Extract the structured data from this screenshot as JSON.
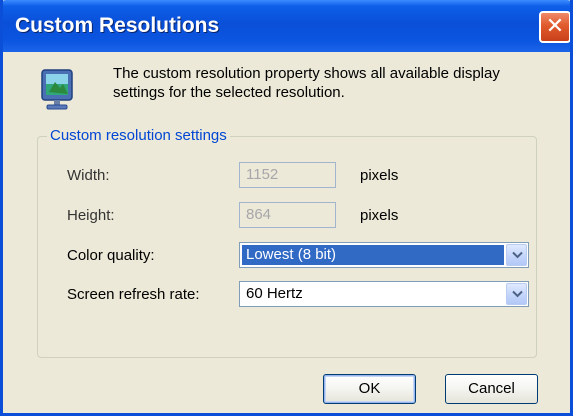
{
  "window": {
    "title": "Custom Resolutions",
    "close_label": "✕"
  },
  "intro": {
    "text": "The custom resolution property shows all available display settings for the selected resolution."
  },
  "group": {
    "label": "Custom resolution settings",
    "width": {
      "label": "Width:",
      "value": "1152",
      "unit": "pixels"
    },
    "height": {
      "label": "Height:",
      "value": "864",
      "unit": "pixels"
    },
    "color_quality": {
      "label": "Color quality:",
      "value": "Lowest (8 bit)"
    },
    "refresh_rate": {
      "label": "Screen refresh rate:",
      "value": "60 Hertz"
    }
  },
  "buttons": {
    "ok": "OK",
    "cancel": "Cancel"
  },
  "colors": {
    "title_bar": "#0b4fd8",
    "close_button": "#e05a2c",
    "group_label": "#0046d5",
    "selection": "#316ac5",
    "dialog_background": "#ece9d8"
  },
  "icons": {
    "window_icon": "display-monitor-icon",
    "close": "close-icon",
    "dropdown": "chevron-down-icon"
  }
}
